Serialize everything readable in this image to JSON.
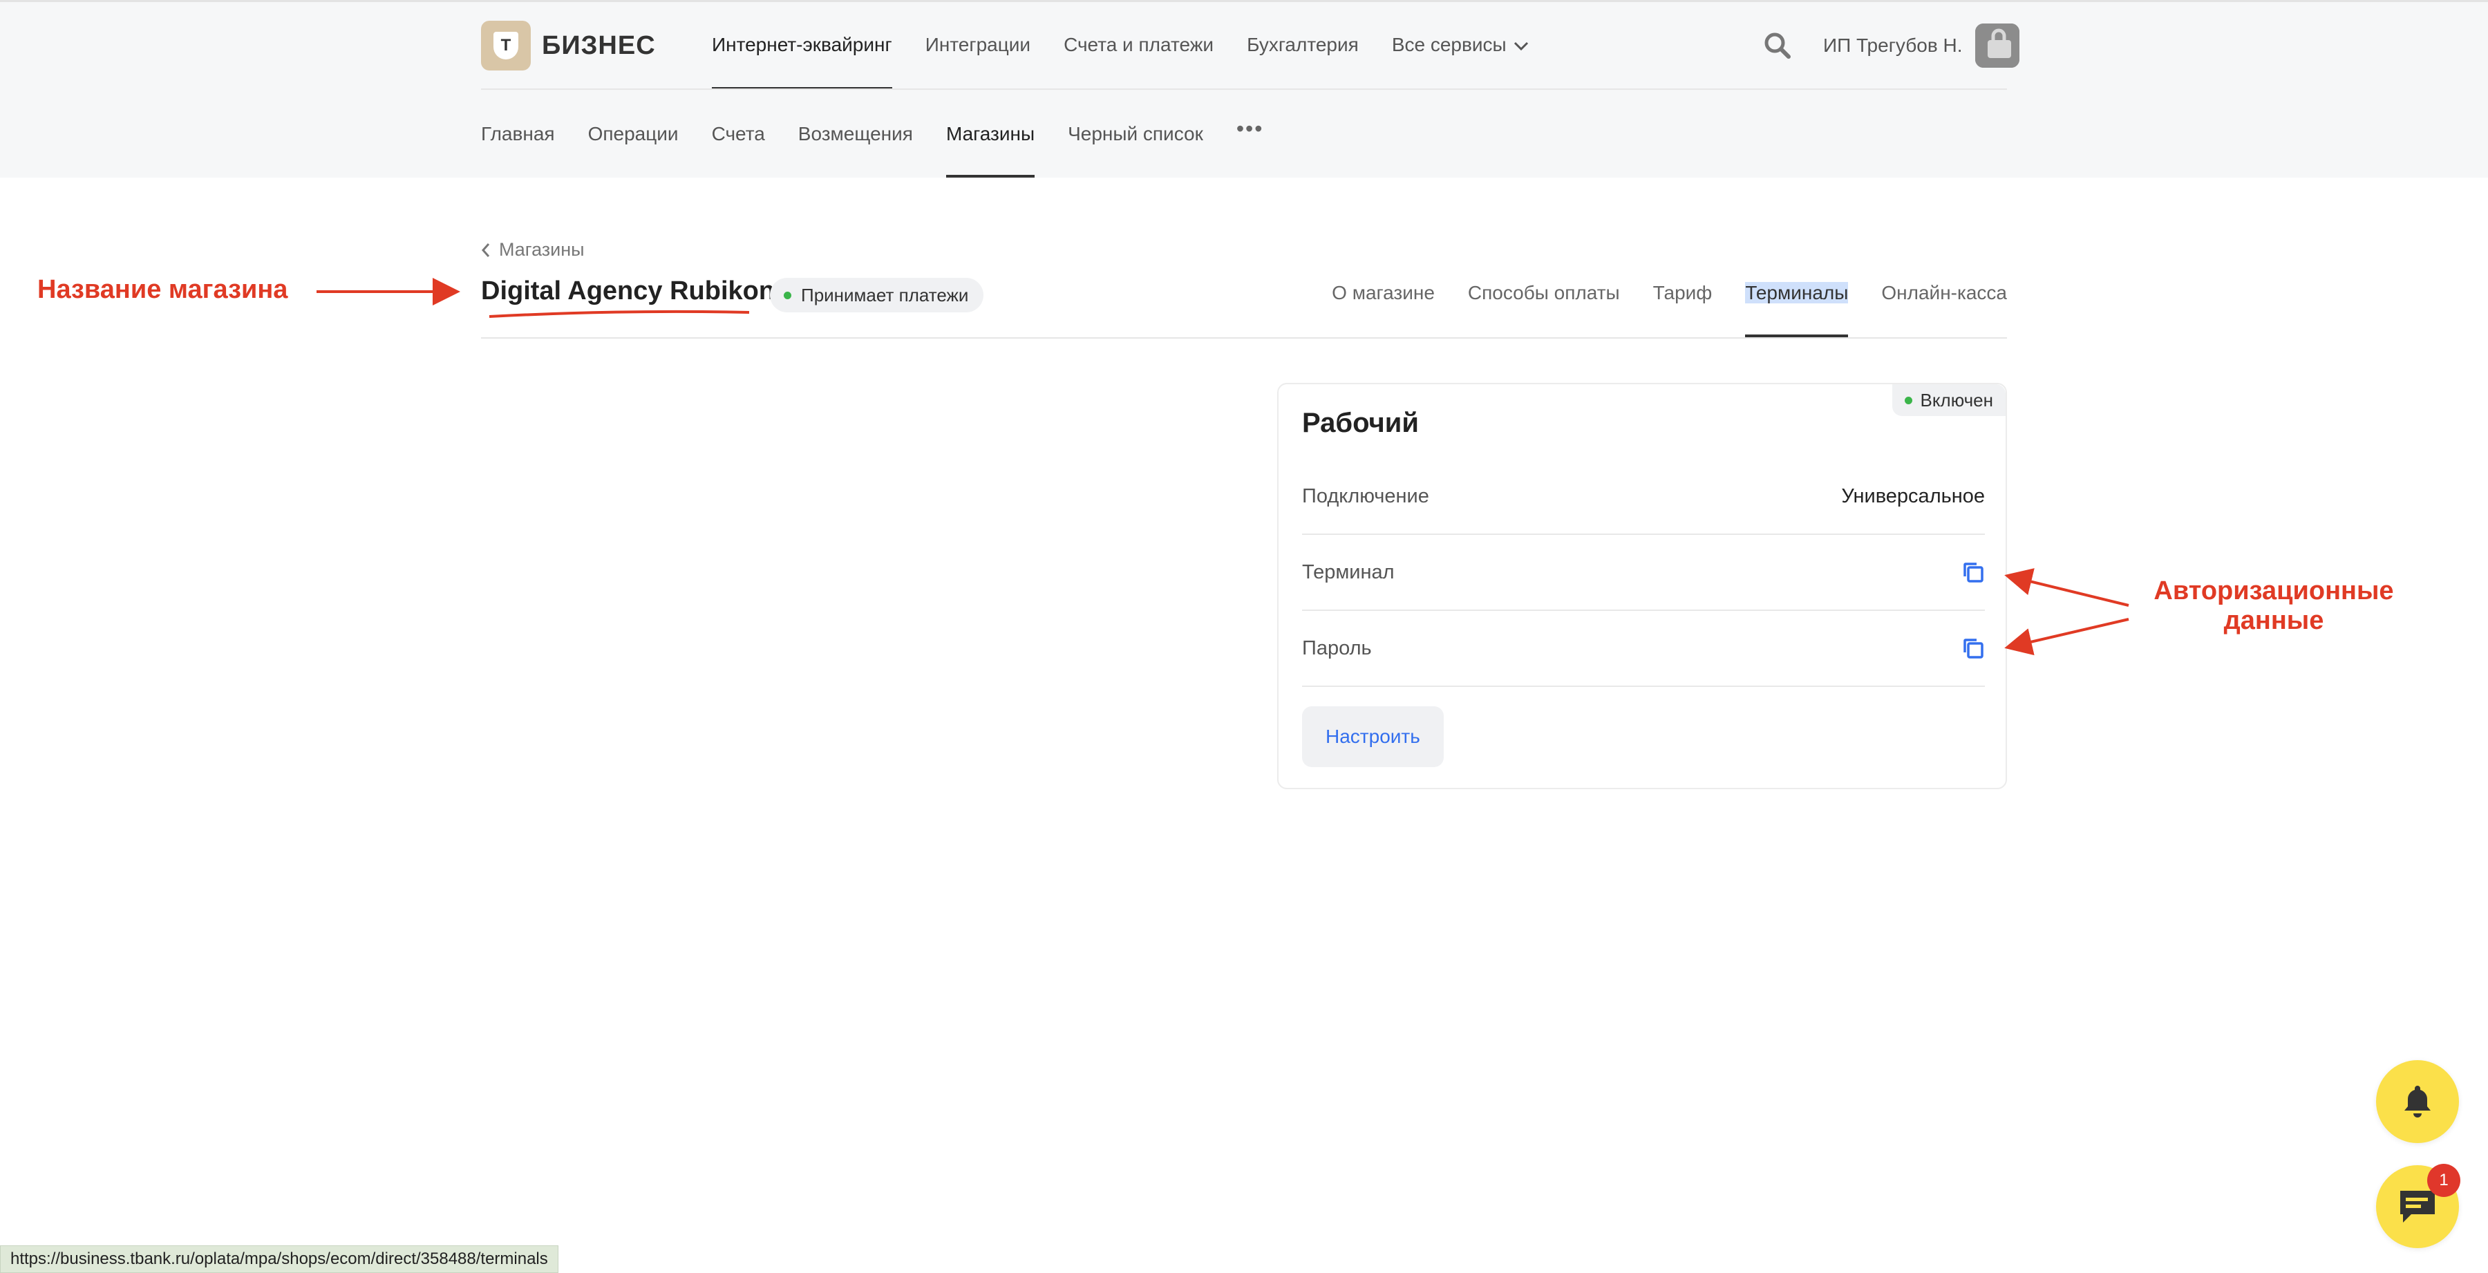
{
  "header": {
    "logo_text": "БИЗНЕС",
    "logo_letter": "T",
    "main_nav": [
      "Интернет-эквайринг",
      "Интеграции",
      "Счета и платежи",
      "Бухгалтерия",
      "Все сервисы"
    ],
    "active_main_nav_index": 0,
    "user_name": "ИП Трегубов Н."
  },
  "sub_nav": {
    "items": [
      "Главная",
      "Операции",
      "Счета",
      "Возмещения",
      "Магазины",
      "Черный список"
    ],
    "active_index": 4,
    "more": "•••"
  },
  "page": {
    "breadcrumb": "Магазины",
    "shop_name": "Digital Agency Rubikon",
    "shop_status": "Принимает платежи",
    "tabs": [
      "О магазине",
      "Способы оплаты",
      "Тариф",
      "Терминалы",
      "Онлайн-касса"
    ],
    "active_tab_index": 3
  },
  "terminal_card": {
    "badge": "Включен",
    "title": "Рабочий",
    "rows": [
      {
        "label": "Подключение",
        "value": "Универсальное"
      },
      {
        "label": "Терминал",
        "value": ""
      },
      {
        "label": "Пароль",
        "value": ""
      }
    ],
    "configure_button": "Настроить"
  },
  "annotations": {
    "shop_name_note": "Название магазина",
    "auth_note_line1": "Авторизационные",
    "auth_note_line2": "данные",
    "color": "#e03a24"
  },
  "chat_badge_count": "1",
  "status_url": "https://business.tbank.ru/oplata/mpa/shops/ecom/direct/358488/terminals",
  "colors": {
    "accent_link": "#336fee",
    "status_green": "#3bb54a",
    "fab_yellow": "#fbe04a",
    "badge_red": "#e0372b"
  }
}
